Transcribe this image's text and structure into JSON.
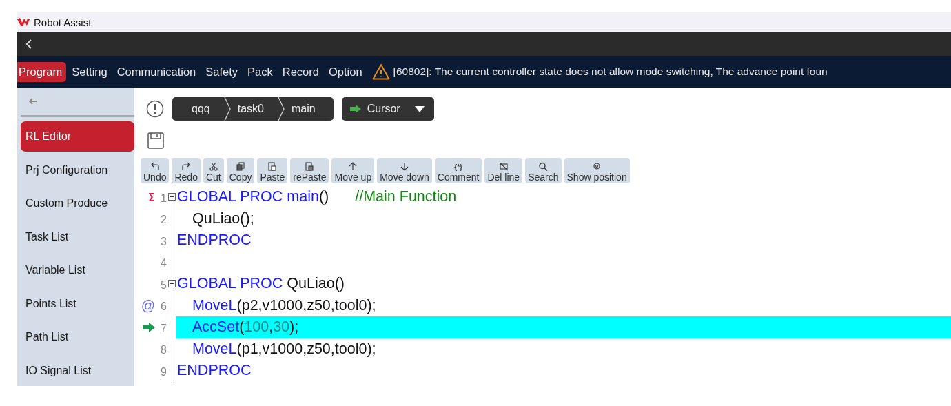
{
  "window": {
    "title": "Robot Assist"
  },
  "nav": {
    "tabs": [
      {
        "label": "Program",
        "selected": true
      },
      {
        "label": "Setting",
        "selected": false
      },
      {
        "label": "Communication",
        "selected": false
      },
      {
        "label": "Safety",
        "selected": false
      },
      {
        "label": "Pack",
        "selected": false
      },
      {
        "label": "Record",
        "selected": false
      },
      {
        "label": "Option",
        "selected": false
      }
    ],
    "alert": "[60802]: The current controller state does not allow mode switching, The advance point foun"
  },
  "sidebar": {
    "items": [
      {
        "label": "RL Editor",
        "selected": true
      },
      {
        "label": "Prj Configuration",
        "selected": false
      },
      {
        "label": "Custom Produce",
        "selected": false
      },
      {
        "label": "Task List",
        "selected": false
      },
      {
        "label": "Variable List",
        "selected": false
      },
      {
        "label": "Points List",
        "selected": false
      },
      {
        "label": "Path List",
        "selected": false
      },
      {
        "label": "IO Signal List",
        "selected": false
      }
    ]
  },
  "breadcrumb": [
    "qqq",
    "task0",
    "main"
  ],
  "mode_dropdown": {
    "value": "Cursor"
  },
  "toolbar": [
    {
      "label": "Undo",
      "kind": "undo"
    },
    {
      "label": "Redo",
      "kind": "redo"
    },
    {
      "label": "Cut",
      "kind": "cut"
    },
    {
      "label": "Copy",
      "kind": "copy"
    },
    {
      "label": "Paste",
      "kind": "paste"
    },
    {
      "label": "rePaste",
      "kind": "repaste"
    },
    {
      "label": "Move up",
      "kind": "up"
    },
    {
      "label": "Move down",
      "kind": "down"
    },
    {
      "label": "Comment",
      "kind": "glyph",
      "glyph": "{*}"
    },
    {
      "label": "Del line",
      "kind": "del"
    },
    {
      "label": "Search",
      "kind": "search"
    },
    {
      "label": "Show position",
      "kind": "position"
    }
  ],
  "code": [
    {
      "number": "1",
      "marker": {
        "kind": "sigma"
      },
      "foldable": true,
      "highlighted": false,
      "indent": false,
      "tokens": [
        {
          "kind": "keyword",
          "text": "GLOBAL PROC main"
        },
        {
          "kind": "plain",
          "text": "()"
        },
        {
          "kind": "gap"
        },
        {
          "kind": "comment",
          "text": "//Main Function"
        }
      ]
    },
    {
      "number": "2",
      "foldable": false,
      "highlighted": false,
      "indent": true,
      "tokens": [
        {
          "kind": "plain",
          "text": "QuLiao();"
        }
      ]
    },
    {
      "number": "3",
      "foldable": false,
      "highlighted": false,
      "indent": false,
      "tokens": [
        {
          "kind": "keyword",
          "text": "ENDPROC"
        }
      ]
    },
    {
      "number": "4",
      "foldable": false,
      "highlighted": false
    },
    {
      "number": "5",
      "foldable": true,
      "highlighted": false,
      "indent": false,
      "tokens": [
        {
          "kind": "keyword",
          "text": "GLOBAL PROC "
        },
        {
          "kind": "plain",
          "text": "QuLiao()"
        }
      ]
    },
    {
      "number": "6",
      "marker": {
        "kind": "text",
        "text": "@"
      },
      "foldable": false,
      "highlighted": false,
      "indent": true,
      "tokens": [
        {
          "kind": "keyword",
          "text": "MoveL"
        },
        {
          "kind": "plain",
          "text": "(p2,v1000,z50,tool0);"
        }
      ]
    },
    {
      "number": "7",
      "marker": {
        "kind": "arrow"
      },
      "foldable": false,
      "highlighted": true,
      "indent": true,
      "tokens": [
        {
          "kind": "keyword",
          "text": "AccSet"
        },
        {
          "kind": "plain",
          "text": "("
        },
        {
          "kind": "number",
          "text": "100"
        },
        {
          "kind": "plain",
          "text": ","
        },
        {
          "kind": "number",
          "text": "30"
        },
        {
          "kind": "plain",
          "text": ");"
        }
      ]
    },
    {
      "number": "8",
      "foldable": false,
      "highlighted": false,
      "indent": true,
      "tokens": [
        {
          "kind": "keyword",
          "text": "MoveL"
        },
        {
          "kind": "plain",
          "text": "(p1,v1000,z50,tool0);"
        }
      ]
    },
    {
      "number": "9",
      "foldable": false,
      "highlighted": false,
      "indent": false,
      "tokens": [
        {
          "kind": "keyword",
          "text": "ENDPROC"
        }
      ]
    }
  ]
}
